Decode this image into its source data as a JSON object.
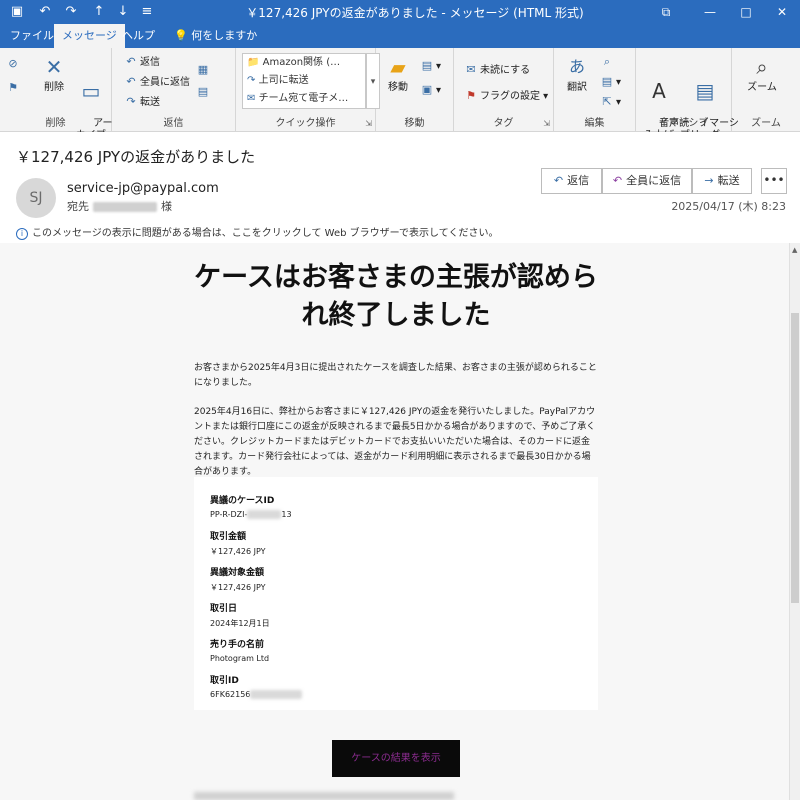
{
  "titlebar": {
    "title": "￥127,426 JPYの返金がありました - メッセージ (HTML 形式)",
    "qa_icons": [
      "save-icon",
      "undo-icon",
      "redo-icon",
      "up-arrow-icon",
      "down-arrow-icon",
      "customize-icon"
    ],
    "window_controls": [
      "restore-ribbon-icon",
      "minimize-icon",
      "maximize-icon",
      "close-icon"
    ]
  },
  "tabs": {
    "file": "ファイル",
    "message": "メッセージ",
    "help": "ヘルプ",
    "tellme": "何をしますか"
  },
  "ribbon": {
    "delete_group": {
      "label": "削除",
      "delete": "削除",
      "archive": "アー\nカイブ"
    },
    "respond_group": {
      "label": "返信",
      "reply": "返信",
      "reply_all": "全員に返信",
      "forward": "転送"
    },
    "quicksteps_group": {
      "label": "クイック操作",
      "items": [
        "Amazon関係 (…",
        "上司に転送",
        "チーム宛て電子メ…"
      ]
    },
    "move_group": {
      "label": "移動",
      "move": "移動"
    },
    "tags_group": {
      "label": "タグ",
      "unread": "未読にする",
      "flag": "フラグの設定"
    },
    "editing_group": {
      "label": "編集",
      "translate": "翻訳"
    },
    "immersive_group": {
      "label": "イマーシブ",
      "read_aloud": "音声読\nみ上げ",
      "immersive_reader": "イマーシ\nブリーダー"
    },
    "zoom_group": {
      "label": "ズーム",
      "zoom": "ズーム"
    }
  },
  "header": {
    "subject": "￥127,426 JPYの返金がありました",
    "avatar_initials": "SJ",
    "sender": "service-jp@paypal.com",
    "to_label": "宛先",
    "to_suffix": "様",
    "reply": "返信",
    "reply_all": "全員に返信",
    "forward": "転送",
    "more": "•••",
    "datetime": "2025/04/17 (木) 8:23",
    "infobar": "このメッセージの表示に問題がある場合は、ここをクリックして Web ブラウザーで表示してください。"
  },
  "email": {
    "headline": "ケースはお客さまの主張が認められ終了しました",
    "para1": "お客さまから2025年4月3日に提出されたケースを調査した結果、お客さまの主張が認められることになりました。",
    "para2": "2025年4月16日に、弊社からお客さまに￥127,426 JPYの返金を発行いたしました。PayPalアカウントまたは銀行口座にこの返金が反映されるまで最長5日かかる場合がありますので、予めご了承ください。クレジットカードまたはデビットカードでお支払いいただいた場合は、そのカードに返金されます。カード発行会社によっては、返金がカード利用明細に表示されるまで最長30日かかる場合があります。",
    "card": {
      "case_id_label": "異議のケースID",
      "case_id_value": "PP-R-DZI-",
      "case_id_tail": "13",
      "amount_label": "取引金額",
      "amount_value": "￥127,426 JPY",
      "disputed_label": "異議対象金額",
      "disputed_value": "￥127,426 JPY",
      "date_label": "取引日",
      "date_value": "2024年12月1日",
      "seller_label": "売り手の名前",
      "seller_value": "Photogram Ltd",
      "txn_label": "取引ID",
      "txn_value": "6FK62156"
    },
    "cta": "ケースの結果を表示"
  },
  "colors": {
    "accent": "#2b6cbe",
    "ribbon_bg": "#f3f3f3",
    "cta_bg": "#0a0a0a",
    "cta_text": "#8b2c8f"
  }
}
